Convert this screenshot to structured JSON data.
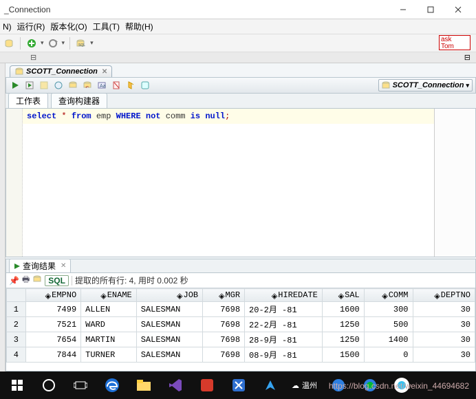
{
  "window": {
    "title": "_Connection"
  },
  "menus": {
    "n": "N)",
    "run": "运行(R)",
    "version": "版本化(O)",
    "tools": "工具(T)",
    "help": "帮助(H)"
  },
  "ask": {
    "line1": "ask",
    "line2": "Tom"
  },
  "connection": {
    "tab_label": "SCOTT_Connection",
    "dropdown_label": "SCOTT_Connection"
  },
  "subtabs": {
    "worksheet": "工作表",
    "builder": "查询构建器"
  },
  "sql": {
    "kw1": "select",
    "op": "*",
    "kw2": "from",
    "tbl": "emp",
    "kw3": "WHERE",
    "kw4": "not",
    "col": "comm",
    "kw5": "is",
    "kw6": "null",
    "semi": ";"
  },
  "results": {
    "tab_label": "查询结果",
    "sql_btn": "SQL",
    "status": "提取的所有行: 4, 用时 0.002 秒",
    "columns": [
      "",
      "EMPNO",
      "ENAME",
      "JOB",
      "MGR",
      "HIREDATE",
      "SAL",
      "COMM",
      "DEPTNO"
    ],
    "rows": [
      {
        "n": "1",
        "empno": "7499",
        "ename": "ALLEN",
        "job": "SALESMAN",
        "mgr": "7698",
        "hiredate": "20-2月 -81",
        "sal": "1600",
        "comm": "300",
        "deptno": "30"
      },
      {
        "n": "2",
        "empno": "7521",
        "ename": "WARD",
        "job": "SALESMAN",
        "mgr": "7698",
        "hiredate": "22-2月 -81",
        "sal": "1250",
        "comm": "500",
        "deptno": "30"
      },
      {
        "n": "3",
        "empno": "7654",
        "ename": "MARTIN",
        "job": "SALESMAN",
        "mgr": "7698",
        "hiredate": "28-9月 -81",
        "sal": "1250",
        "comm": "1400",
        "deptno": "30"
      },
      {
        "n": "4",
        "empno": "7844",
        "ename": "TURNER",
        "job": "SALESMAN",
        "mgr": "7698",
        "hiredate": "08-9月 -81",
        "sal": "1500",
        "comm": "0",
        "deptno": "30"
      }
    ]
  },
  "taskbar": {
    "weather": "温州",
    "url_text": "https://blog.csdn.net/weixin_44694682"
  },
  "watermark": ""
}
